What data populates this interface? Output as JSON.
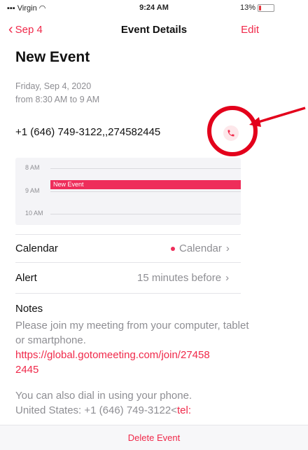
{
  "status_bar": {
    "carrier": "Virgin",
    "time": "9:24 AM",
    "battery": "13%",
    "battery_level": 0.13
  },
  "nav": {
    "back_label": "Sep 4",
    "title": "Event Details",
    "edit_label": "Edit"
  },
  "event": {
    "title": "New Event",
    "date": "Friday, Sep 4, 2020",
    "time_range": "from 8:30 AM to 9 AM",
    "phone": "+1 (646) 749-3122,,274582445"
  },
  "timeline": {
    "hours": [
      "8 AM",
      "9 AM",
      "10 AM"
    ],
    "event_label": "New Event"
  },
  "details": {
    "calendar_label": "Calendar",
    "calendar_value": "Calendar",
    "alert_label": "Alert",
    "alert_value": "15 minutes before",
    "notes_label": "Notes"
  },
  "notes": {
    "text1": "Please join my meeting from your computer, tablet or smartphone.",
    "link1": "https://global.gotomeeting.com/join/274582445",
    "text2": "You can also dial in using your phone.",
    "text3": "United States: +1 (646) 749-3122<",
    "link2": "tel:"
  },
  "footer": {
    "delete_label": "Delete Event"
  },
  "colors": {
    "accent": "#f0294a",
    "annotation": "#e3001b"
  },
  "icons": [
    "wifi-icon",
    "battery-icon",
    "chevron-left-icon",
    "phone-icon",
    "chevron-right-icon",
    "arrow-annotation"
  ]
}
